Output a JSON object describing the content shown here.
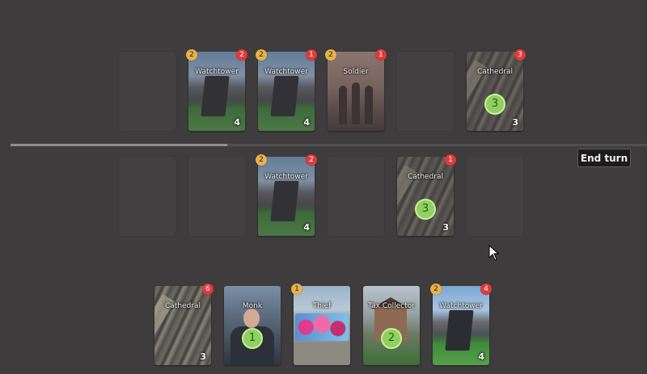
{
  "controls": {
    "end_turn_label": "End turn",
    "turn_progress_percent": 34
  },
  "opponent_row": {
    "slots": [
      {
        "empty": true
      },
      {
        "name": "Watchtower",
        "cost": "2",
        "damage": "2",
        "power": "4",
        "art": "watchtower"
      },
      {
        "name": "Watchtower",
        "cost": "2",
        "damage": "1",
        "power": "4",
        "art": "watchtower"
      },
      {
        "name": "Soldier",
        "cost": "2",
        "damage": "1",
        "power": "",
        "art": "soldier"
      },
      {
        "empty": true
      },
      {
        "name": "Cathedral",
        "cost": "",
        "damage": "3",
        "power": "3",
        "coin": "3",
        "art": "cathedral"
      }
    ]
  },
  "player_row": {
    "slots": [
      {
        "empty": true
      },
      {
        "empty": true
      },
      {
        "name": "Watchtower",
        "cost": "2",
        "damage": "2",
        "power": "4",
        "art": "watchtower"
      },
      {
        "empty": true
      },
      {
        "name": "Cathedral",
        "cost": "",
        "damage": "1",
        "power": "3",
        "coin": "3",
        "art": "cathedral"
      },
      {
        "empty": true
      }
    ]
  },
  "hand": {
    "cards": [
      {
        "name": "Cathedral",
        "cost": "",
        "damage": "6",
        "power": "3",
        "art": "cathedral"
      },
      {
        "name": "Monk",
        "cost": "",
        "damage": "",
        "power": "",
        "coin": "1",
        "art": "monk"
      },
      {
        "name": "Thief",
        "cost": "1",
        "damage": "",
        "power": "",
        "art": "thief"
      },
      {
        "name": "Tax Collector",
        "cost": "",
        "damage": "",
        "power": "",
        "coin": "2",
        "art": "taxcollector"
      },
      {
        "name": "Watchtower",
        "cost": "2",
        "damage": "4",
        "power": "4",
        "art": "watchtower"
      }
    ]
  },
  "colors": {
    "background": "#3f3c3d",
    "cost_badge": "#e7b24a",
    "damage_badge": "#de3b3b",
    "coin": "#8fd060"
  }
}
